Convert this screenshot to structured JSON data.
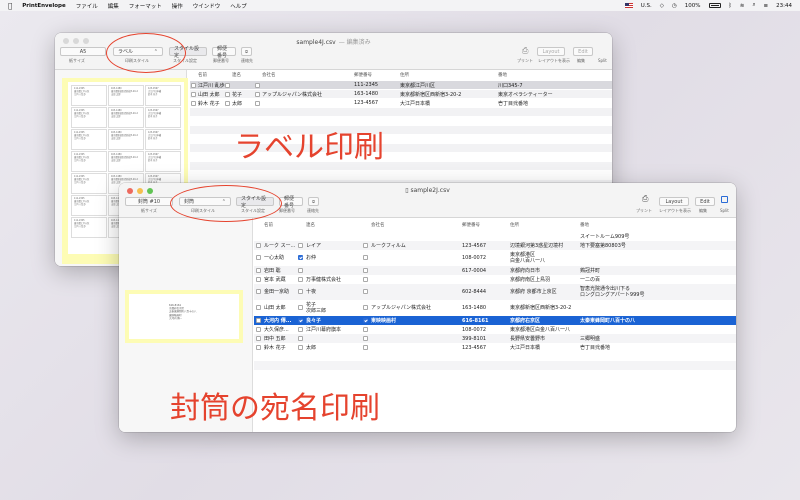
{
  "menubar": {
    "app_name": "PrintEnvelope",
    "items": [
      "ファイル",
      "編集",
      "フォーマット",
      "操作",
      "ウインドウ",
      "ヘルプ"
    ],
    "input_source": "U.S.",
    "battery": "100%",
    "clock": "23:44"
  },
  "windowA": {
    "title": "sample4J.csv",
    "subtitle": "— 編集済み",
    "toolbar": {
      "paper_size": "A5",
      "paper_caption": "紙サイズ",
      "print_style": "ラベル",
      "print_style_caption": "印刷スタイル",
      "style_settings": "スタイル設定",
      "style_settings_caption": "スタイル設定",
      "postal": "郵便番号",
      "postal_caption": "郵便番号",
      "address_book_caption": "連絡先",
      "print_caption": "プリント",
      "layout": "Layout",
      "layout_caption": "レイアウトを表示",
      "edit": "Edit",
      "edit_caption": "編集",
      "split_caption": "Split"
    },
    "columns": [
      "名前",
      "連名",
      "会社名",
      "郵便番号",
      "住所",
      "番地"
    ],
    "rows": [
      {
        "name": "江戸川 乱歩",
        "joint": "",
        "company": "",
        "zip": "111-2345",
        "address": "東京都江戸川区",
        "block": "川口345-7",
        "selected": true
      },
      {
        "name": "山田 太郎",
        "joint": "花子",
        "company": "アップルジャパン株式会社",
        "zip": "163-1480",
        "address": "東京都新宿区西新宿3-20-2",
        "block": "東京オペラシティーター"
      },
      {
        "name": "鈴木 花子",
        "joint": "太郎",
        "company": "",
        "zip": "123-4567",
        "address": "大江戸日本橋",
        "block": "壱丁目弐番地"
      }
    ]
  },
  "windowB": {
    "title": "sample2J.csv",
    "toolbar": {
      "paper_size": "封筒 #10",
      "paper_caption": "紙サイズ",
      "print_style": "封筒",
      "print_style_caption": "印刷スタイル",
      "style_settings": "スタイル設定",
      "style_settings_caption": "スタイル設定",
      "postal": "郵便番号",
      "postal_caption": "郵便番号",
      "address_book_caption": "連絡先",
      "print_caption": "プリント",
      "layout": "Layout",
      "layout_caption": "レイアウトを表示",
      "edit": "Edit",
      "edit_caption": "編集",
      "split_caption": "Split"
    },
    "columns": [
      "名前",
      "連名",
      "会社名",
      "郵便番号",
      "住所",
      "番地"
    ],
    "rows": [
      {
        "name": "",
        "joint": "",
        "company": "",
        "zip": "",
        "address": "",
        "block": "スイートルーム909号",
        "h": 1
      },
      {
        "name": "ルーク スー...",
        "joint": "レイア",
        "company": "ルークフィルム",
        "zip": "123-4567",
        "address": "辺境銀河第3惑星辺境村",
        "block": "地下要塞第80803号",
        "h": 1
      },
      {
        "name": "一心太助",
        "joint": "お仲",
        "joint_checked": true,
        "company": "",
        "zip": "108-0072",
        "address": "東京都港区\n白金八百八一八",
        "block": "",
        "h": 2
      },
      {
        "name": "岩田 聡",
        "joint": "",
        "company": "",
        "zip": "617-0004",
        "address": "京都府向日市",
        "block": "鶏冠井町",
        "h": 1
      },
      {
        "name": "宮本 武蔵",
        "joint": "万事健株式会社",
        "company": "",
        "zip": "",
        "address": "京都府南区上鳥羽",
        "block": "一二の百",
        "h": 1
      },
      {
        "name": "金田一京助",
        "joint": "十夜",
        "company": "",
        "zip": "602-8444",
        "address": "京都府 京都市上京区",
        "block": "智恵光院通今出川下る\nロングロングアパート999号",
        "h": 2
      },
      {
        "name": "山田 太郎",
        "joint": "花子\n次郎三郎",
        "company": "アップルジャパン株式会社",
        "zip": "163-1480",
        "address": "東京都新宿区西新宿3-20-2",
        "block": "",
        "h": 2
      },
      {
        "name": "大河内 傳...",
        "joint": "良々子",
        "joint_checked": true,
        "company": "東映映画村",
        "company_checked": true,
        "zip": "616-8161",
        "address": "京都府右京区",
        "block": "太秦東蜂岡町八百十の八",
        "h": 1,
        "selected": true
      },
      {
        "name": "大久保彦...",
        "joint": "江戸川幕府旗本",
        "company": "",
        "zip": "108-0072",
        "address": "東京都港区白金八百八一八",
        "block": "",
        "h": 1
      },
      {
        "name": "田中 五郎",
        "joint": "",
        "company": "",
        "zip": "399-8101",
        "address": "長野県安曇野市",
        "block": "三郷明盛",
        "h": 1
      },
      {
        "name": "鈴木 花子",
        "joint": "太郎",
        "company": "",
        "zip": "123-4567",
        "address": "大江戸日本橋",
        "block": "壱丁目弐番地",
        "h": 1
      }
    ]
  },
  "annotations": {
    "label_caption": "ラベル印刷",
    "envelope_caption": "封筒の宛名印刷"
  },
  "colors": {
    "annotation_red": "#e5432e",
    "selection_blue": "#1a63d4",
    "preview_yellow": "#fdfcb5"
  }
}
